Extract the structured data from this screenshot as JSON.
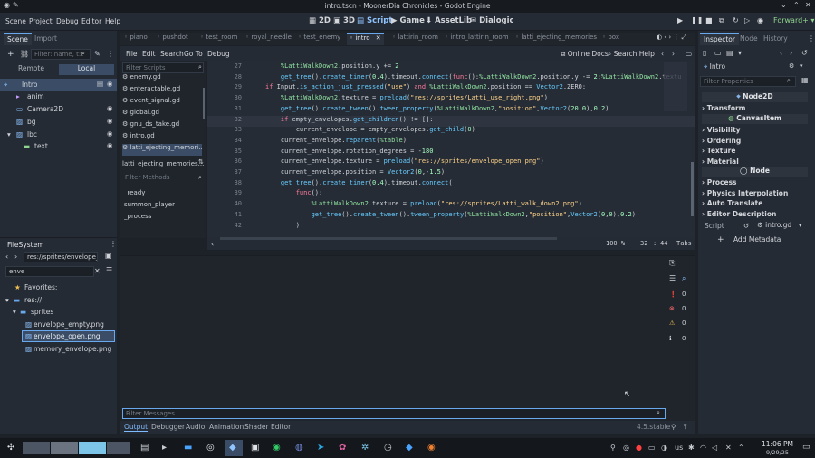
{
  "window": {
    "title": "intro.tscn - MoonerDia Chronicles - Godot Engine"
  },
  "menubar": {
    "menus": [
      "Scene",
      "Project",
      "Debug",
      "Editor",
      "Help"
    ],
    "workspaces": [
      "2D",
      "3D",
      "Script",
      "Game",
      "AssetLib",
      "Dialogic"
    ],
    "active_workspace": "Script",
    "renderer": "Forward+"
  },
  "scene_dock": {
    "tabs": [
      "Scene",
      "Import"
    ],
    "filter_placeholder": "Filter: name, t:t",
    "remote_label": "Remote",
    "local_label": "Local",
    "nodes": [
      {
        "name": "Intro",
        "depth": 0,
        "selected": true
      },
      {
        "name": "anim",
        "depth": 1
      },
      {
        "name": "Camera2D",
        "depth": 1
      },
      {
        "name": "bg",
        "depth": 1
      },
      {
        "name": "lbc",
        "depth": 1
      },
      {
        "name": "text",
        "depth": 2
      }
    ]
  },
  "filesystem": {
    "title": "FileSystem",
    "path": "res://sprites/envelope_op",
    "search_value": "enve",
    "favorites_label": "Favorites:",
    "root_label": "res://",
    "folder_label": "sprites",
    "files": [
      "envelope_empty.png",
      "envelope_open.png",
      "memory_envelope.png"
    ],
    "selected_file": "envelope_open.png"
  },
  "script_tabs": [
    "piano",
    "pushdot",
    "test_room",
    "royal_needle",
    "test_enemy",
    "intro",
    "lattirin_room",
    "intro_lattirin_room",
    "latti_ejecting_memories",
    "box"
  ],
  "active_script_tab": "intro",
  "script_menu": {
    "items": [
      "File",
      "Edit",
      "Search",
      "Go To",
      "Debug"
    ],
    "online_docs": "Online Docs",
    "search_help": "Search Help"
  },
  "script_list": {
    "filter_placeholder": "Filter Scripts",
    "items": [
      "enemy.gd",
      "enteractable.gd",
      "event_signal.gd",
      "global.gd",
      "gnu_ds_take.gd",
      "intro.gd",
      "latti_ejecting_memori..."
    ],
    "selected": "intro.gd",
    "current_script": "latti_ejecting_memories...",
    "methods_placeholder": "Filter Methods",
    "methods": [
      "_ready",
      "summon_player",
      "_process"
    ]
  },
  "code": {
    "current_line": 32,
    "lines": [
      {
        "n": 27,
        "text": "    %LattiWalkDown2.position.y += 2"
      },
      {
        "n": 28,
        "text": "    get_tree().create_timer(0.4).timeout.connect(func():%LattiWalkDown2.position.y -= 2;%LattiWalkDown2.textu"
      },
      {
        "n": 29,
        "text": "if Input.is_action_just_pressed(\"use\") and %LattiWalkDown2.position == Vector2.ZERO:"
      },
      {
        "n": 30,
        "text": "    %LattiWalkDown2.texture = preload(\"res://sprites/Latti_use_right.png\")"
      },
      {
        "n": 31,
        "text": "    get_tree().create_tween().tween_property(%LattiWalkDown2,\"position\",Vector2(20,0),0.2)"
      },
      {
        "n": 32,
        "text": "    if empty_envelopes.get_children() != []:"
      },
      {
        "n": 33,
        "text": "        current_envelope = empty_envelopes.get_child(0)"
      },
      {
        "n": 34,
        "text": "    current_envelope.reparent(%table)"
      },
      {
        "n": 35,
        "text": "    current_envelope.rotation_degrees = -180"
      },
      {
        "n": 36,
        "text": "    current_envelope.texture = preload(\"res://sprites/envelope_open.png\")"
      },
      {
        "n": 37,
        "text": "    current_envelope.position = Vector2(0,-1.5)"
      },
      {
        "n": 38,
        "text": "    get_tree().create_timer(0.4).timeout.connect("
      },
      {
        "n": 39,
        "text": "        func():"
      },
      {
        "n": 40,
        "text": "            %LattiWalkDown2.texture = preload(\"res://sprites/Latti_walk_down2.png\")"
      },
      {
        "n": 41,
        "text": "            get_tree().create_tween().tween_property(%LattiWalkDown2,\"position\",Vector2(0,0),0.2)"
      },
      {
        "n": 42,
        "text": "        )"
      }
    ]
  },
  "editor_status": {
    "zoom": "100 %",
    "line": "32",
    "col": "44",
    "indent": "Tabs"
  },
  "output": {
    "filter_placeholder": "Filter Messages",
    "counts": [
      "0",
      "0",
      "0",
      "0"
    ],
    "bottom_tabs": [
      "Output",
      "Debugger",
      "Audio",
      "Animation",
      "Shader Editor"
    ],
    "active_tab": "Output",
    "version": "4.5.stable"
  },
  "inspector": {
    "tabs": [
      "Inspector",
      "Node",
      "History"
    ],
    "object_name": "Intro",
    "filter_placeholder": "Filter Properties",
    "sections": [
      {
        "type": "header",
        "label": "Node2D"
      },
      {
        "type": "group",
        "label": "Transform"
      },
      {
        "type": "header",
        "label": "CanvasItem"
      },
      {
        "type": "group",
        "label": "Visibility"
      },
      {
        "type": "group",
        "label": "Ordering"
      },
      {
        "type": "group",
        "label": "Texture"
      },
      {
        "type": "group",
        "label": "Material"
      },
      {
        "type": "header",
        "label": "Node"
      },
      {
        "type": "group",
        "label": "Process"
      },
      {
        "type": "group",
        "label": "Physics Interpolation"
      },
      {
        "type": "group",
        "label": "Auto Translate"
      },
      {
        "type": "group",
        "label": "Editor Description"
      }
    ],
    "script_label": "Script",
    "script_value": "intro.gd",
    "add_metadata": "Add Metadata"
  },
  "taskbar": {
    "keyboard": "us",
    "time": "11:06 PM",
    "date": "9/29/25"
  }
}
